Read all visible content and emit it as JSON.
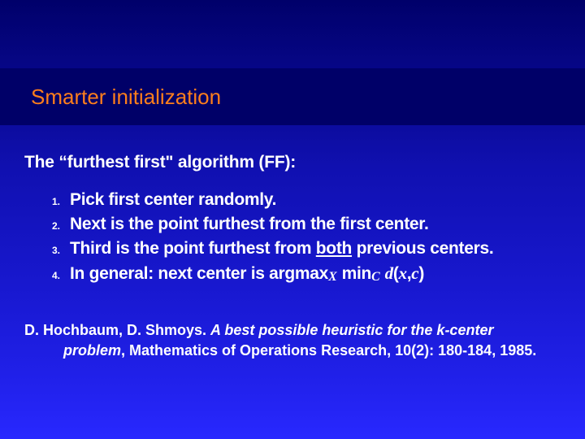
{
  "title": "Smarter initialization",
  "subtitle": "The “furthest first\" algorithm (FF):",
  "list": {
    "items": [
      {
        "num": "1.",
        "text": "Pick first center randomly."
      },
      {
        "num": "2.",
        "text": "Next is the point furthest from the first center."
      },
      {
        "num": "3.",
        "prefix": "Third is the point furthest from ",
        "underlined": "both",
        "suffix": " previous centers."
      },
      {
        "num": "4.",
        "prefix": "In general: next center is argmax",
        "sub1": "X",
        "mid": " min",
        "sub2": "C",
        "space": " ",
        "dvar": "d",
        "paren_open": "(",
        "xvar": "x",
        "comma": ",",
        "cvar": "c",
        "paren_close": ")"
      }
    ]
  },
  "citation": {
    "authors": "D. Hochbaum, D. Shmoys. ",
    "title": "A best possible heuristic for the k-center",
    "title2": "problem",
    "rest": ", Mathematics of Operations Research, 10(2): 180-184, 1985."
  }
}
